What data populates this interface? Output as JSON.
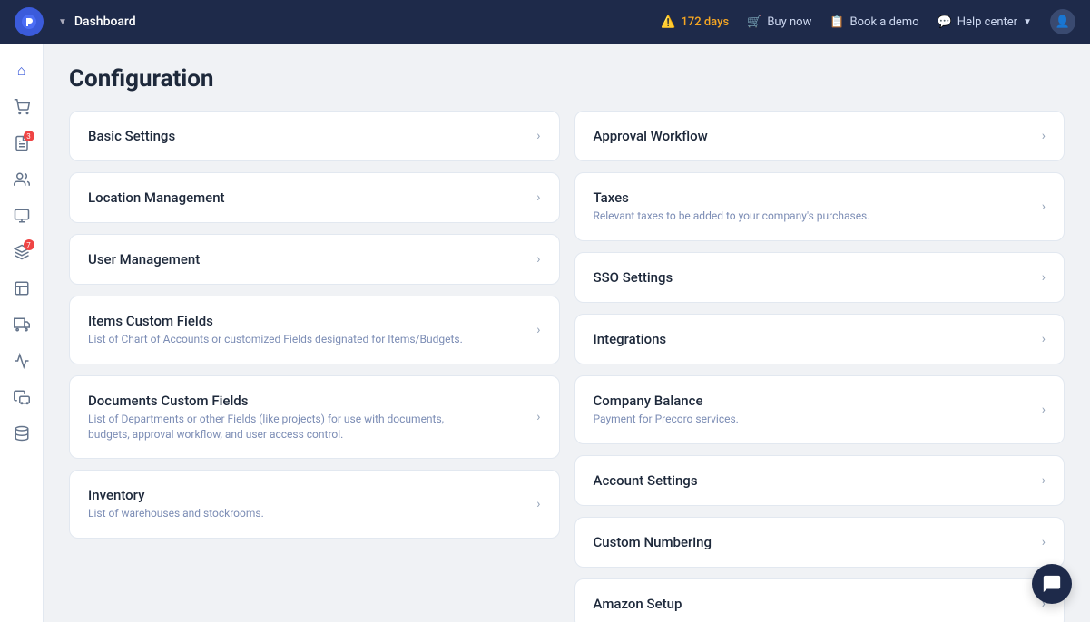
{
  "topnav": {
    "logo_text": "P",
    "breadcrumb": "Dashboard",
    "warning_days": "172 days",
    "buy_now": "Buy now",
    "book_demo": "Book a demo",
    "help_center": "Help center"
  },
  "page": {
    "title": "Configuration"
  },
  "sidebar": {
    "items": [
      {
        "id": "home",
        "icon": "⌂"
      },
      {
        "id": "shopping",
        "icon": "🛒"
      },
      {
        "id": "orders",
        "icon": "📋",
        "badge": "3"
      },
      {
        "id": "users",
        "icon": "👥"
      },
      {
        "id": "purchase",
        "icon": "🛍"
      },
      {
        "id": "invoices",
        "icon": "🧾",
        "badge": "7"
      },
      {
        "id": "reports",
        "icon": "📊"
      },
      {
        "id": "delivery",
        "icon": "🚚"
      },
      {
        "id": "analytics",
        "icon": "📈"
      },
      {
        "id": "truck",
        "icon": "🚛"
      },
      {
        "id": "database",
        "icon": "🗄"
      }
    ]
  },
  "left_cards": [
    {
      "id": "basic-settings",
      "title": "Basic Settings",
      "description": ""
    },
    {
      "id": "location-management",
      "title": "Location Management",
      "description": ""
    },
    {
      "id": "user-management",
      "title": "User Management",
      "description": ""
    },
    {
      "id": "items-custom-fields",
      "title": "Items Custom Fields",
      "description": "List of Chart of Accounts or customized Fields designated for Items/Budgets."
    },
    {
      "id": "documents-custom-fields",
      "title": "Documents Custom Fields",
      "description": "List of Departments or other Fields (like projects) for use with documents, budgets, approval workflow, and user access control."
    },
    {
      "id": "inventory",
      "title": "Inventory",
      "description": "List of warehouses and stockrooms."
    }
  ],
  "right_cards": [
    {
      "id": "approval-workflow",
      "title": "Approval Workflow",
      "description": ""
    },
    {
      "id": "taxes",
      "title": "Taxes",
      "description": "Relevant taxes to be added to your company's purchases."
    },
    {
      "id": "sso-settings",
      "title": "SSO Settings",
      "description": ""
    },
    {
      "id": "integrations",
      "title": "Integrations",
      "description": ""
    },
    {
      "id": "company-balance",
      "title": "Company Balance",
      "description": "Payment for Precoro services."
    },
    {
      "id": "account-settings",
      "title": "Account Settings",
      "description": ""
    },
    {
      "id": "custom-numbering",
      "title": "Custom Numbering",
      "description": ""
    },
    {
      "id": "amazon-setup",
      "title": "Amazon Setup",
      "description": ""
    }
  ]
}
